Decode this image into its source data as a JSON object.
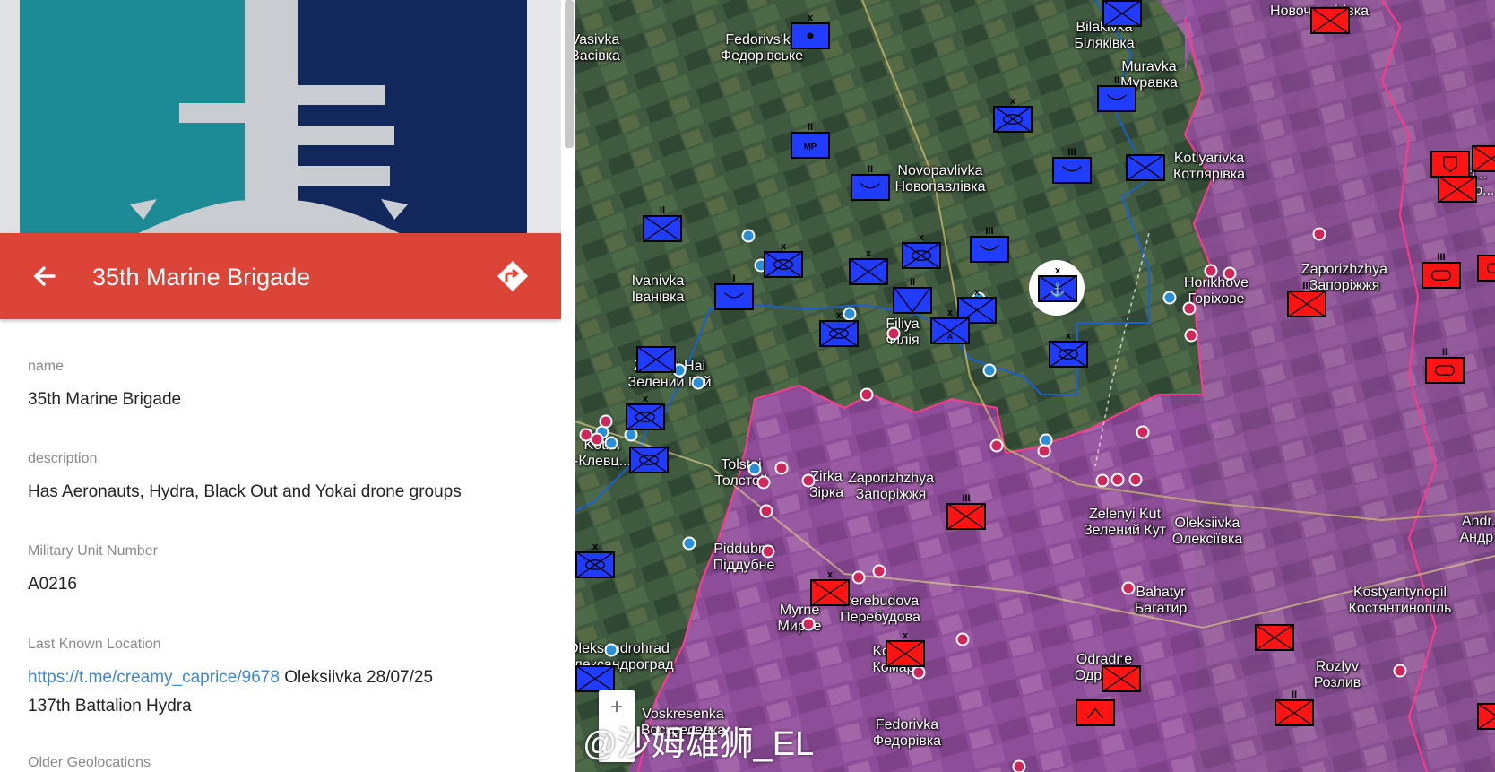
{
  "panel": {
    "title": "35th Marine Brigade",
    "fields": [
      {
        "label": "name",
        "value": "35th Marine Brigade"
      },
      {
        "label": "description",
        "value": "Has Aeronauts, Hydra, Black Out and Yokai drone groups"
      },
      {
        "label": "Military Unit Number",
        "value": "A0216"
      },
      {
        "label": "Last Known Location",
        "link": "https://t.me/creamy_caprice/9678",
        "value": " Oleksiivka 28/07/25",
        "value2": "137th Battalion Hydra"
      },
      {
        "label": "Older Geolocations"
      }
    ],
    "colors": {
      "header": "#db4437",
      "link": "#3f86d4"
    }
  },
  "map": {
    "labels": [
      {
        "id": "fedorivska",
        "en": "Fedorivs'ka",
        "uk": "Федорівське"
      },
      {
        "id": "bilakivka",
        "en": "Bilakivka",
        "uk": "Біляківка"
      },
      {
        "id": "muravka",
        "en": "Muravka",
        "uk": "Муравка"
      },
      {
        "id": "novopavlivka",
        "en": "Novopavlivka",
        "uk": "Новопавлівка"
      },
      {
        "id": "kotlyarivka",
        "en": "Kotlyarivka",
        "uk": "Котлярівка"
      },
      {
        "id": "ivanivka",
        "en": "Ivanivka",
        "uk": "Іванівка"
      },
      {
        "id": "horikhove",
        "en": "Horikhove",
        "uk": "Горіхове"
      },
      {
        "id": "zaporizhzhya-ne",
        "en": "Zaporizhzhya",
        "uk": "Запоріжжя"
      },
      {
        "id": "filiya",
        "en": "Filiya",
        "uk": "Філія"
      },
      {
        "id": "zelenyi-hai",
        "en": "Zelenyi Hai",
        "uk": "Зелений Гай"
      },
      {
        "id": "zirka",
        "en": "Zirka",
        "uk": "Зірка"
      },
      {
        "id": "zaporizhzhya-c",
        "en": "Zaporizhzhya",
        "uk": "Запоріжжя"
      },
      {
        "id": "tolstoi",
        "en": "Tolstoi",
        "uk": "Толстой"
      },
      {
        "id": "zelenyi-kut",
        "en": "Zelenyi Kut",
        "uk": "Зелений Кут"
      },
      {
        "id": "oleksiivka",
        "en": "Oleksiivka",
        "uk": "Олексіївка"
      },
      {
        "id": "pidubne",
        "en": "Piddubne",
        "uk": "Піддубне"
      },
      {
        "id": "myrne",
        "en": "Myrne",
        "uk": "Мирне"
      },
      {
        "id": "perebudova",
        "en": "Perebudova",
        "uk": "Перебудова"
      },
      {
        "id": "bahatyr",
        "en": "Bahatyr",
        "uk": "Багатир"
      },
      {
        "id": "kostiantynopil",
        "en": "Kostyantynopil",
        "uk": "Костянтинопіль"
      },
      {
        "id": "oleksandrohrad",
        "en": "Oleksandrohrad",
        "uk": "Олександроград"
      },
      {
        "id": "komar",
        "en": "Komar",
        "uk": "Комар"
      },
      {
        "id": "odradne",
        "en": "Odradne",
        "uk": "Одрадне"
      },
      {
        "id": "rozlyv",
        "en": "Rozlyv",
        "uk": "Розлив"
      },
      {
        "id": "voskresenka",
        "en": "Voskresenka",
        "uk": "Воскресенка"
      },
      {
        "id": "fedorivka",
        "en": "Fedorivka",
        "uk": "Федорівка"
      },
      {
        "id": "novo-e",
        "en": "No...",
        "uk": "Ново..."
      },
      {
        "id": "novoch-top",
        "en": "Новочернігівка",
        "uk": ""
      },
      {
        "id": "kotl-left",
        "en": "Kotl...",
        "uk": "-Клевц..."
      },
      {
        "id": "vasivka",
        "en": "Vasivka",
        "uk": "Васівка"
      },
      {
        "id": "andr",
        "en": "Andr...",
        "uk": "Андр..."
      }
    ],
    "unit_texts": {
      "mp": "MP",
      "a": "A"
    },
    "watermark": "@沙姆雄狮_EL",
    "zoom_plus": "+",
    "colors": {
      "ua_unit": "#1f3cff",
      "ru_unit": "#ff1414",
      "ua_dot": "#2a8fd6",
      "ru_dot": "#d0275a",
      "occupied": "#8a3aa8",
      "frontline": "#ff3a8c",
      "ua_line": "#1c5fd0"
    }
  }
}
